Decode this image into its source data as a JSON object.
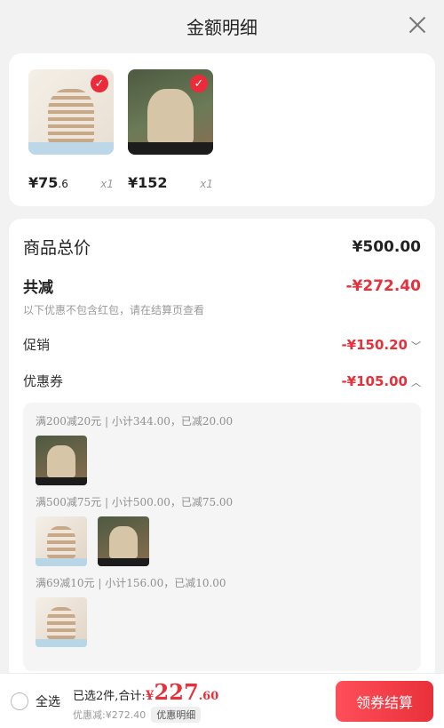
{
  "header": {
    "title": "金额明细"
  },
  "products": [
    {
      "price_int": "¥75",
      "price_dec": ".6",
      "qty": "x1"
    },
    {
      "price_int": "¥152",
      "price_dec": "",
      "qty": "x1"
    }
  ],
  "summary": {
    "total_label": "商品总价",
    "total_value": "¥500.00",
    "discount_label": "共减",
    "discount_value": "-¥272.40",
    "note": "以下优惠不包含红包，请在结算页查看",
    "promo_label": "促销",
    "promo_value": "-¥150.20",
    "coupon_label": "优惠券",
    "coupon_value": "-¥105.00"
  },
  "coupons": [
    {
      "rule": "满200减20元 | 小计344.00，已减20.00"
    },
    {
      "rule": "满500减75元 | 小计500.00，已减75.00"
    },
    {
      "rule": "满69减10元 | 小计156.00，已减10.00"
    }
  ],
  "bottom": {
    "select_all": "全选",
    "selected_text": "已选2件,合计:",
    "yen": "¥",
    "sum_int": "227",
    "sum_dec": ".60",
    "discount_text": "优惠减:¥272.40",
    "detail_tag": "优惠明细",
    "checkout": "领券结算"
  },
  "colors": {
    "accent": "#e8303a",
    "background": "#f2f2f2"
  }
}
